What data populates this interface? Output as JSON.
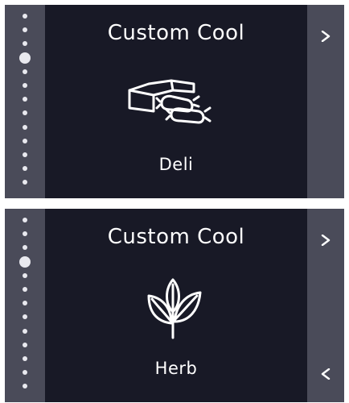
{
  "screens": [
    {
      "title": "Custom Cool",
      "mode_label": "Deli",
      "icon": "deli-cheese-sausage-icon",
      "next_glyph": ">",
      "prev_glyph": null,
      "page_count": 13,
      "active_page": 4
    },
    {
      "title": "Custom Cool",
      "mode_label": "Herb",
      "icon": "herb-leaves-icon",
      "next_glyph": ">",
      "prev_glyph": "<",
      "page_count": 13,
      "active_page": 4
    }
  ],
  "colors": {
    "panel_bg": "#181926",
    "rail_bg": "#4a4b59",
    "text": "#ffffff",
    "dot": "#e9e9ef"
  }
}
